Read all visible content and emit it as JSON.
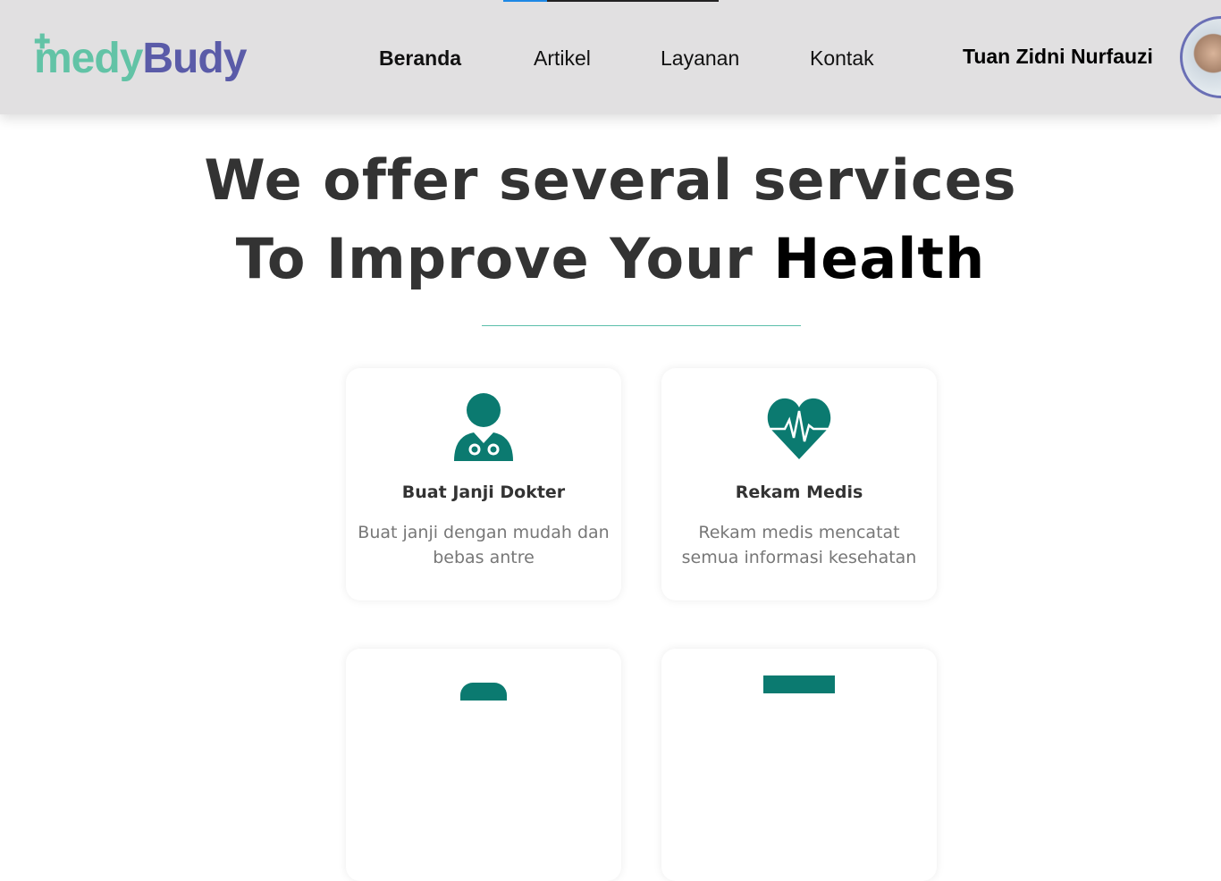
{
  "header": {
    "logo": {
      "part1": "medy",
      "part2": "Budy"
    },
    "nav": [
      "Beranda",
      "Artikel",
      "Layanan",
      "Kontak"
    ],
    "user_name": "Tuan Zidni Nurfauzi"
  },
  "hero": {
    "line1": "We offer several services",
    "line2_prefix": "To Improve Your",
    "line2_highlight": "Health"
  },
  "services": [
    {
      "icon": "doctor-icon",
      "title": "Buat Janji Dokter",
      "desc": "Buat janji dengan mudah dan bebas antre"
    },
    {
      "icon": "heart-pulse-icon",
      "title": "Rekam Medis",
      "desc": "Rekam medis mencatat semua informasi kesehatan"
    }
  ],
  "colors": {
    "accent": "#0b7a70",
    "logo_green": "#62c3a6",
    "logo_purple": "#5a5ba8"
  }
}
